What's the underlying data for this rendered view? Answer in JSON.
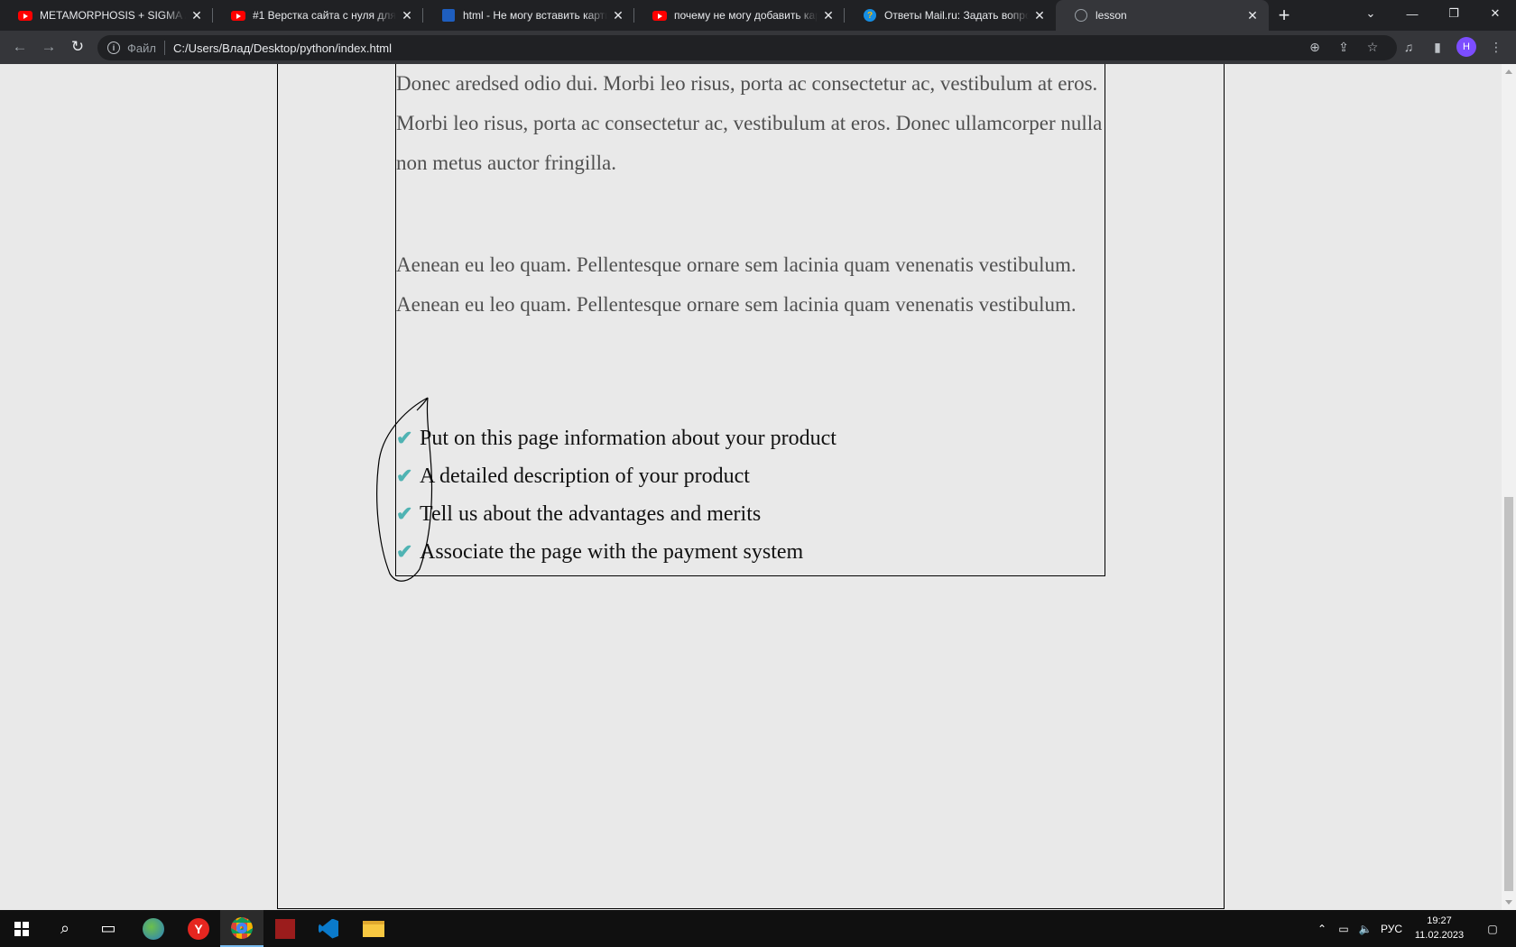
{
  "browser": {
    "tabs": [
      {
        "title": "METAMORPHOSIS + SIGMA // S",
        "icon": "youtube-icon"
      },
      {
        "title": "#1 Верстка сайта с нуля для на",
        "icon": "youtube-icon"
      },
      {
        "title": "html - Не могу вставить картин",
        "icon": "stackoverflow-icon"
      },
      {
        "title": "почему не могу добавить карт",
        "icon": "youtube-icon"
      },
      {
        "title": "Ответы Mail.ru: Задать вопрос",
        "icon": "mailru-answers-icon"
      },
      {
        "title": "lesson",
        "icon": "globe-icon"
      }
    ],
    "address": {
      "scheme_label": "Файл",
      "url": "C:/Users/Влад/Desktop/python/index.html"
    },
    "profile_initial": "H"
  },
  "page": {
    "paragraph_1": "Donec aredsed odio dui. Morbi leo risus, porta ac consectetur ac, vestibulum at eros. Morbi leo risus, porta ac consectetur ac, vestibulum at eros. Donec ullamcorper nulla non metus auctor fringilla.",
    "paragraph_2": "Aenean eu leo quam. Pellentesque ornare sem lacinia quam venenatis vestibulum. Aenean eu leo quam. Pellentesque ornare sem lacinia quam venenatis vestibulum.",
    "features": [
      "Put on this page information about your product",
      "A detailed description of your product",
      "Tell us about the advantages and merits",
      "Associate the page with the payment system"
    ],
    "check_color": "#4fb3b3"
  },
  "taskbar": {
    "language": "РУС",
    "time": "19:27",
    "date": "11.02.2023"
  }
}
